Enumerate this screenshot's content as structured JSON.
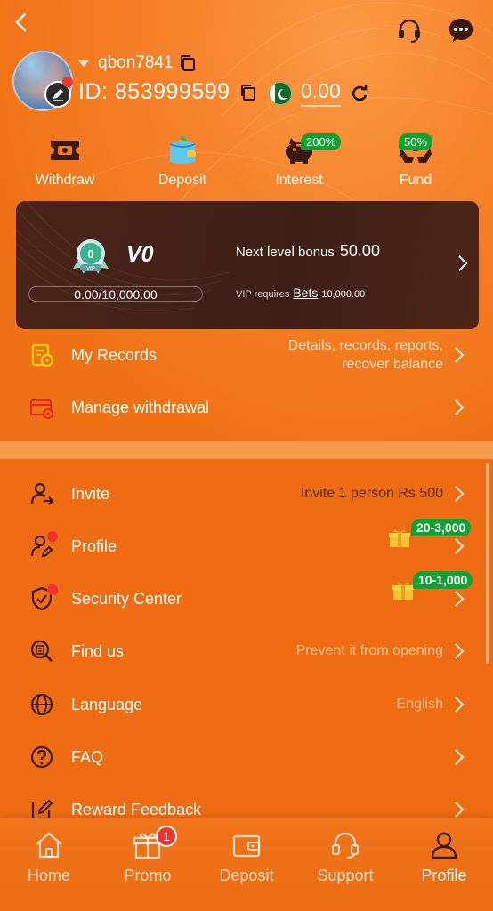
{
  "header": {
    "username": "qbon7841",
    "id_text": "ID: 853999599",
    "balance": "0.00"
  },
  "quick_actions": [
    {
      "label": "Withdraw",
      "icon": "ticket-icon"
    },
    {
      "label": "Deposit",
      "icon": "wallet-icon"
    },
    {
      "label": "Interest",
      "icon": "piggy-bank-icon",
      "badge": "200%"
    },
    {
      "label": "Fund",
      "icon": "hands-coin-icon",
      "badge": "50%"
    }
  ],
  "vip": {
    "medal_level": "0",
    "medal_label": "VIP",
    "level": "V0",
    "progress_text": "0.00/10,000.00",
    "progress_fraction": 0.0,
    "next_bonus_label": "Next level bonus",
    "next_bonus_value": "50.00",
    "requires_label": "VIP requires",
    "requires_link": "Bets",
    "requires_value": "10,000.00"
  },
  "records": {
    "label": "My Records",
    "detail_line1": "Details, records, reports,",
    "detail_line2": "recover balance"
  },
  "manage_withdrawal": {
    "label": "Manage withdrawal"
  },
  "menu": [
    {
      "key": "invite",
      "label": "Invite",
      "right": "Invite 1 person Rs 500"
    },
    {
      "key": "profile",
      "label": "Profile",
      "badge": "20-3,000"
    },
    {
      "key": "security",
      "label": "Security Center",
      "badge": "10-1,000"
    },
    {
      "key": "findus",
      "label": "Find us",
      "right": "Prevent it from opening"
    },
    {
      "key": "language",
      "label": "Language",
      "right": "English"
    },
    {
      "key": "faq",
      "label": "FAQ"
    },
    {
      "key": "feedback",
      "label": "Reward Feedback"
    }
  ],
  "tabbar": [
    {
      "label": "Home"
    },
    {
      "label": "Promo",
      "badge": "1"
    },
    {
      "label": "Deposit"
    },
    {
      "label": "Support"
    },
    {
      "label": "Profile",
      "active": true
    }
  ],
  "colors": {
    "background": "#ef6c12",
    "vip_card": "#3e1f15",
    "badge_green": "#0fa336",
    "dot_red": "#f2322d"
  }
}
